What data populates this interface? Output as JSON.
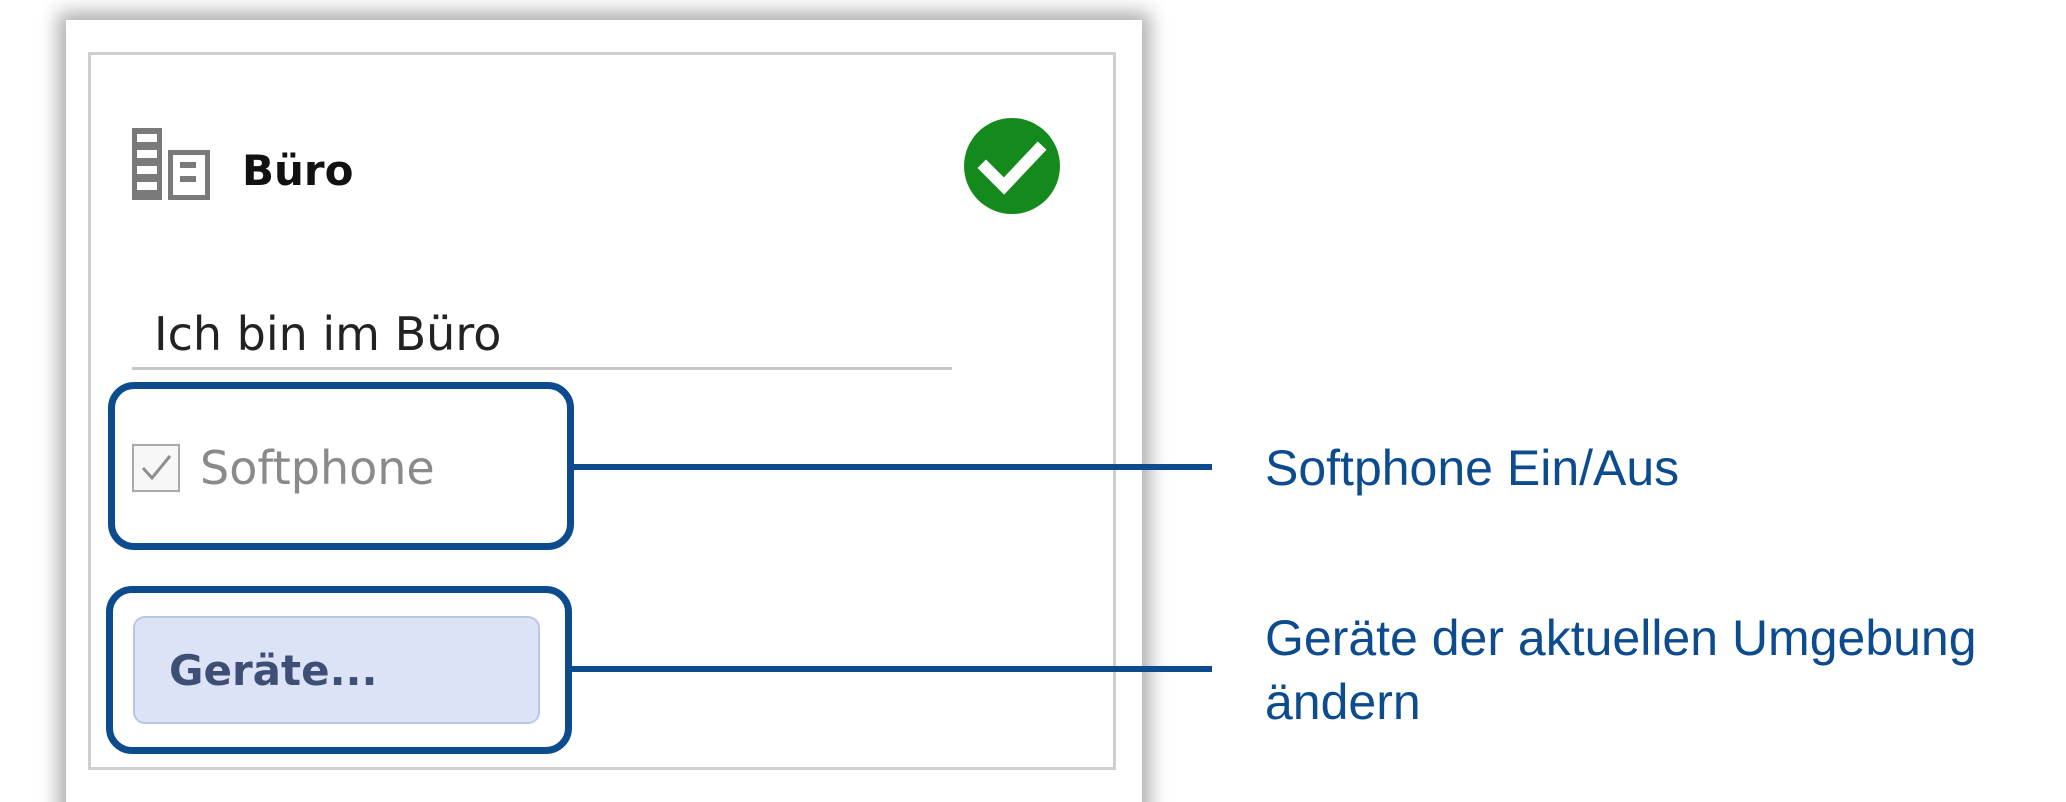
{
  "panel": {
    "title": "Büro",
    "title_icon": "office-building-icon",
    "status_icon": "green-checkmark-icon",
    "status_text_value": "Ich bin im Büro",
    "softphone": {
      "label": "Softphone",
      "checked": true,
      "enabled": false
    },
    "devices_button_label": "Geräte..."
  },
  "annotations": {
    "softphone_callout": "Softphone Ein/Aus",
    "devices_callout_line1": "Geräte der aktuellen Umgebung",
    "devices_callout_line2": "ändern"
  },
  "colors": {
    "accent": "#0d4b8f",
    "status_ok": "#158a1c",
    "button_bg": "#dde3f7"
  }
}
